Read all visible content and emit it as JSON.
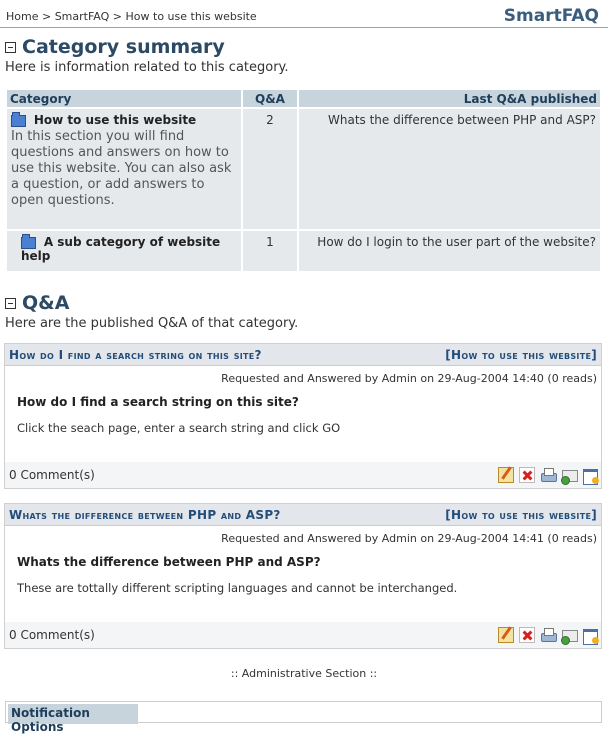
{
  "breadcrumb": {
    "home": "Home",
    "sep1": ">",
    "module": "SmartFAQ",
    "sep2": ">",
    "current": "How to use this website"
  },
  "brand": "SmartFAQ",
  "category_summary": {
    "title": "Category summary",
    "description": "Here is information related to this category.",
    "columns": {
      "category": "Category",
      "qa": "Q&A",
      "last": "Last Q&A published"
    },
    "rows": [
      {
        "name": "How to use this website",
        "description": "In this section you will find questions and answers on how to use this website. You can also ask a question, or add answers to open questions.",
        "count": "2",
        "last": "Whats the difference between PHP and ASP?"
      },
      {
        "name": "A sub category of website help",
        "description": "",
        "count": "1",
        "last": "How do I login to the user part of the website?"
      }
    ]
  },
  "qa_section": {
    "title": "Q&A",
    "description": "Here are the published Q&A of that category.",
    "items": [
      {
        "question_header": "How do I find a search string on this site?",
        "category_link": "[How to use this website]",
        "meta": "Requested and Answered by Admin on 29-Aug-2004 14:40 (0 reads)",
        "question": "How do I find a search string on this site?",
        "answer": "Click the seach page, enter a search string and click GO",
        "comments": "0 Comment(s)"
      },
      {
        "question_header": "Whats the difference between PHP and ASP?",
        "category_link": "[How to use this website]",
        "meta": "Requested and Answered by Admin on 29-Aug-2004 14:41 (0 reads)",
        "question": "Whats the difference between PHP and ASP?",
        "answer": "These are tottally different scripting languages and cannot be interchanged.",
        "comments": "0 Comment(s)"
      }
    ]
  },
  "admin_section": ":: Administrative Section ::",
  "notification": {
    "title": "Notification Options"
  },
  "icons": [
    "edit-icon",
    "delete-icon",
    "print-icon",
    "send-email-icon",
    "subscribe-icon"
  ]
}
